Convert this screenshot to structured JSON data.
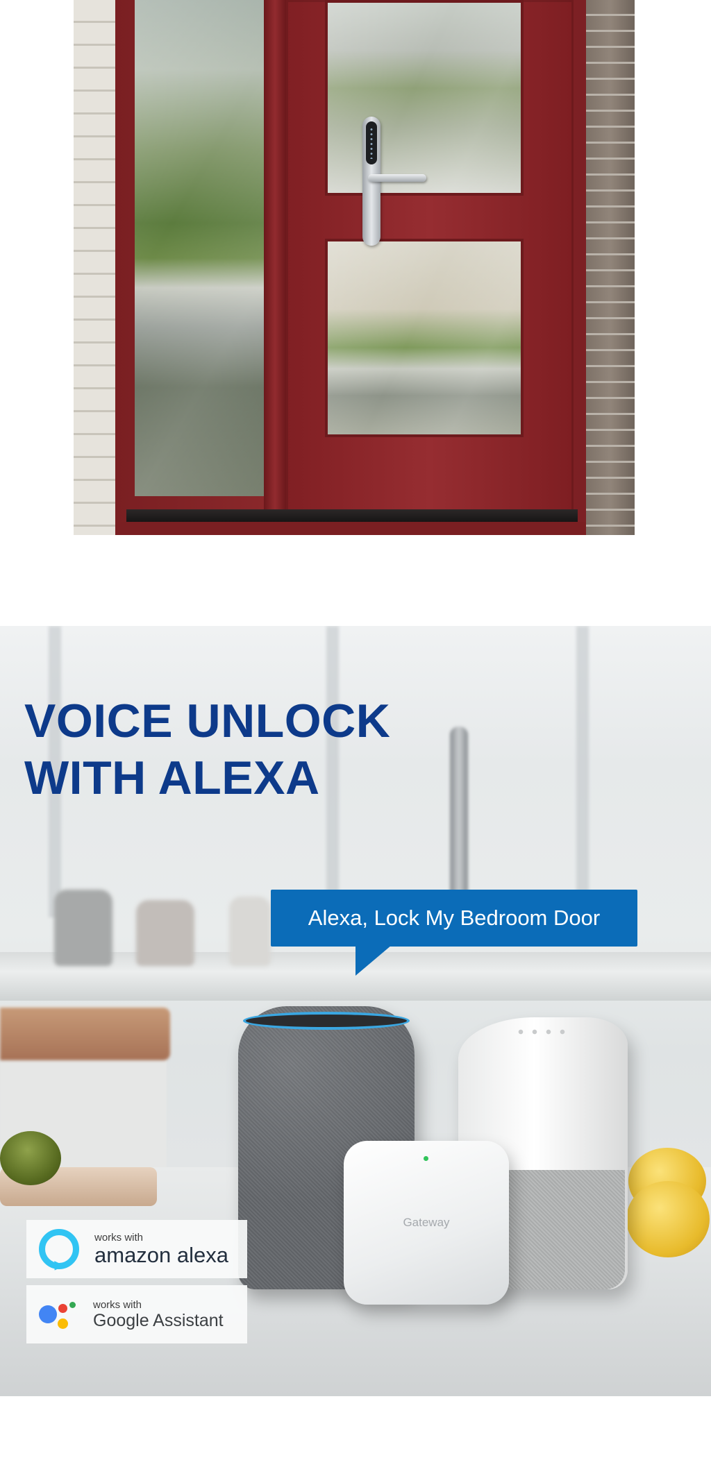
{
  "voice_section": {
    "headline_line1": "VOICE UNLOCK",
    "headline_line2": "WITH ALEXA",
    "speech_bubble": "Alexa, Lock My Bedroom Door",
    "gateway_label": "Gateway",
    "badges": [
      {
        "works_with": "works with",
        "brand": "amazon alexa",
        "icon": "alexa-ring-icon"
      },
      {
        "works_with": "works with",
        "brand": "Google Assistant",
        "icon": "google-assistant-dots-icon"
      }
    ]
  },
  "colors": {
    "headline": "#0d3a8a",
    "bubble": "#0b6cb8",
    "door_red": "#8e2a2d",
    "alexa_blue": "#31c4f3"
  }
}
